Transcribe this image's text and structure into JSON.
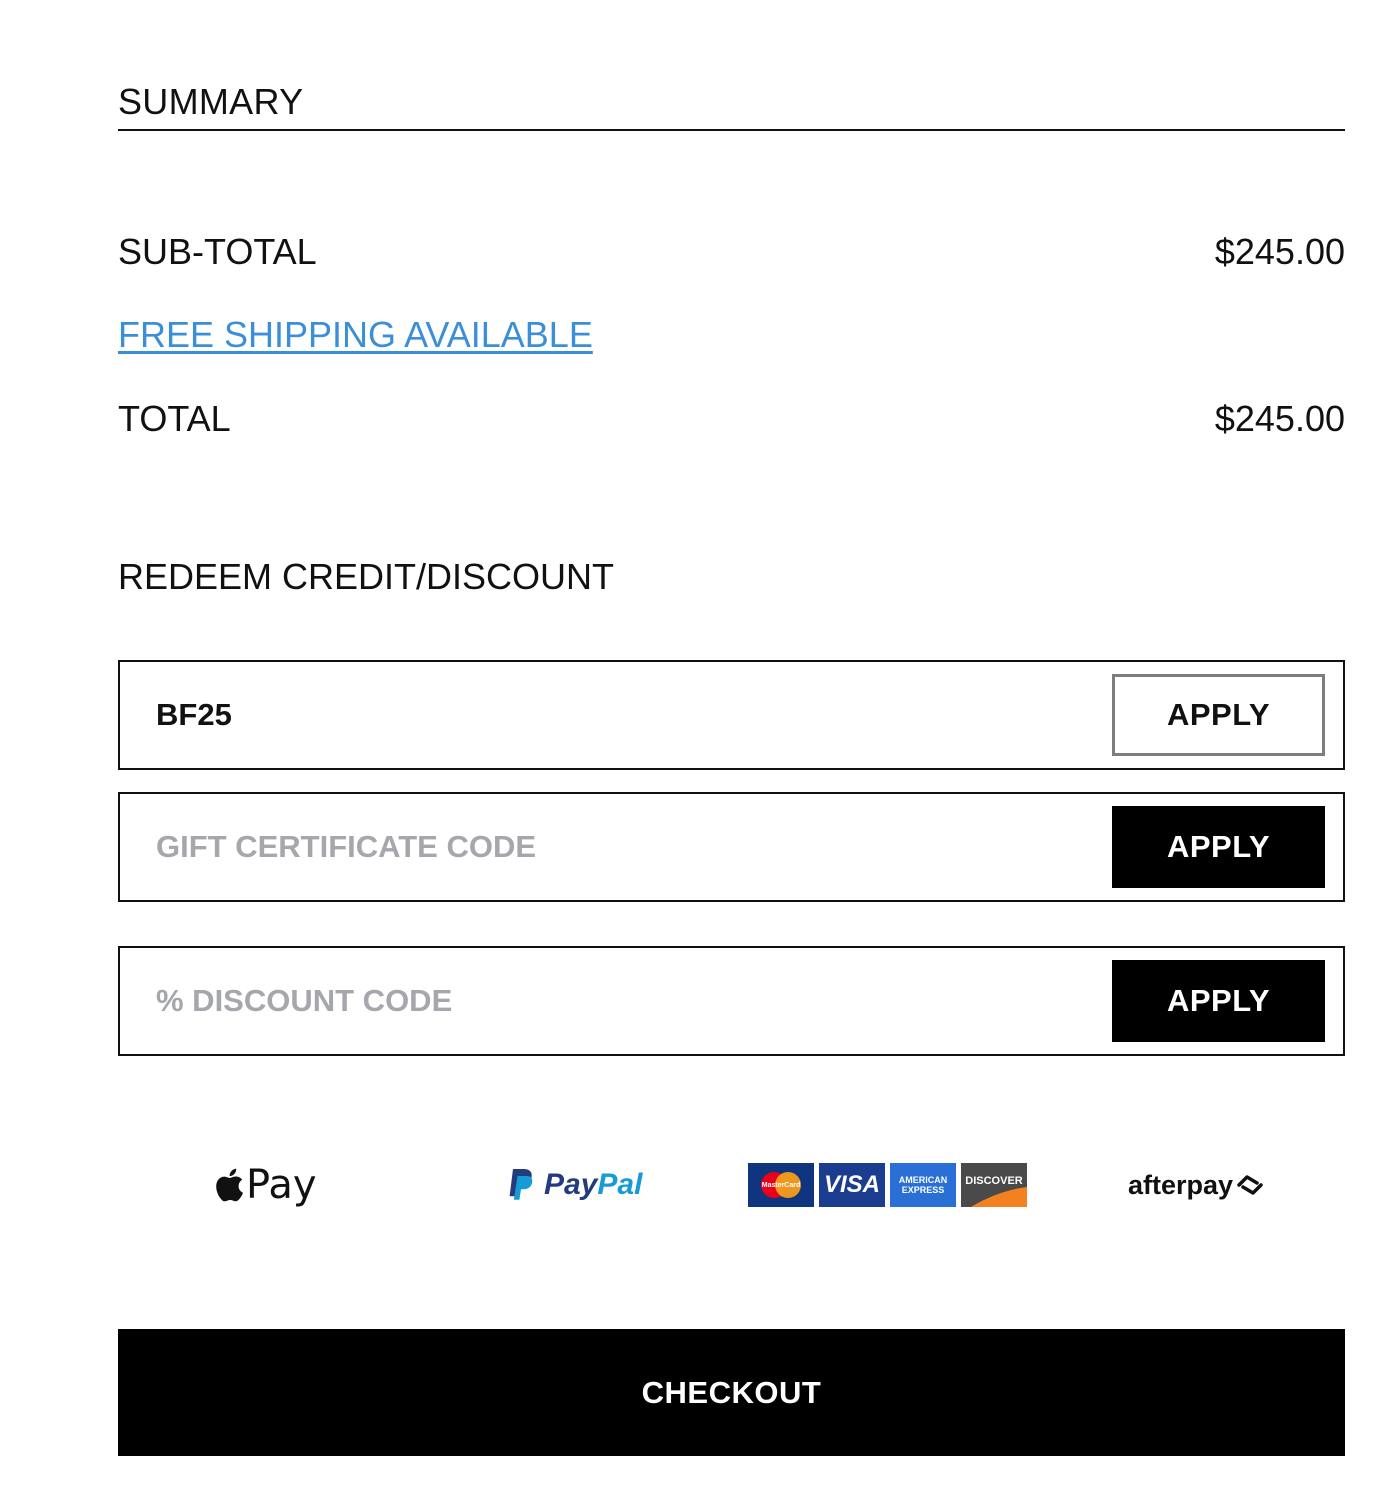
{
  "summary": {
    "title": "SUMMARY",
    "subtotal_label": "SUB-TOTAL",
    "subtotal_value": "$245.00",
    "shipping_link": "FREE SHIPPING AVAILABLE",
    "total_label": "TOTAL",
    "total_value": "$245.00"
  },
  "redeem": {
    "title": "REDEEM CREDIT/DISCOUNT",
    "codes": [
      {
        "value": "BF25",
        "placeholder": "",
        "button_label": "APPLY",
        "button_style": "outline"
      },
      {
        "value": "",
        "placeholder": "GIFT CERTIFICATE CODE",
        "button_label": "APPLY",
        "button_style": "filled"
      },
      {
        "value": "",
        "placeholder": "% DISCOUNT CODE",
        "button_label": "APPLY",
        "button_style": "filled"
      }
    ]
  },
  "payment_methods": {
    "apple_pay": "Pay",
    "paypal_pay": "Pay",
    "paypal_pal": "Pal",
    "cards": {
      "mastercard": "MasterCard",
      "visa": "VISA",
      "amex": "AMERICAN EXPRESS",
      "discover": "DISCOVER"
    },
    "afterpay": "afterpay"
  },
  "checkout": {
    "label": "CHECKOUT"
  },
  "colors": {
    "link": "#3b8fd9",
    "button_fill": "#000000",
    "placeholder": "#a5a7ad",
    "paypal_dark": "#253b80",
    "paypal_light": "#179bd7",
    "discover_orange": "#f48120",
    "mastercard_red": "#eb001b",
    "mastercard_yellow": "#f79e1b"
  }
}
